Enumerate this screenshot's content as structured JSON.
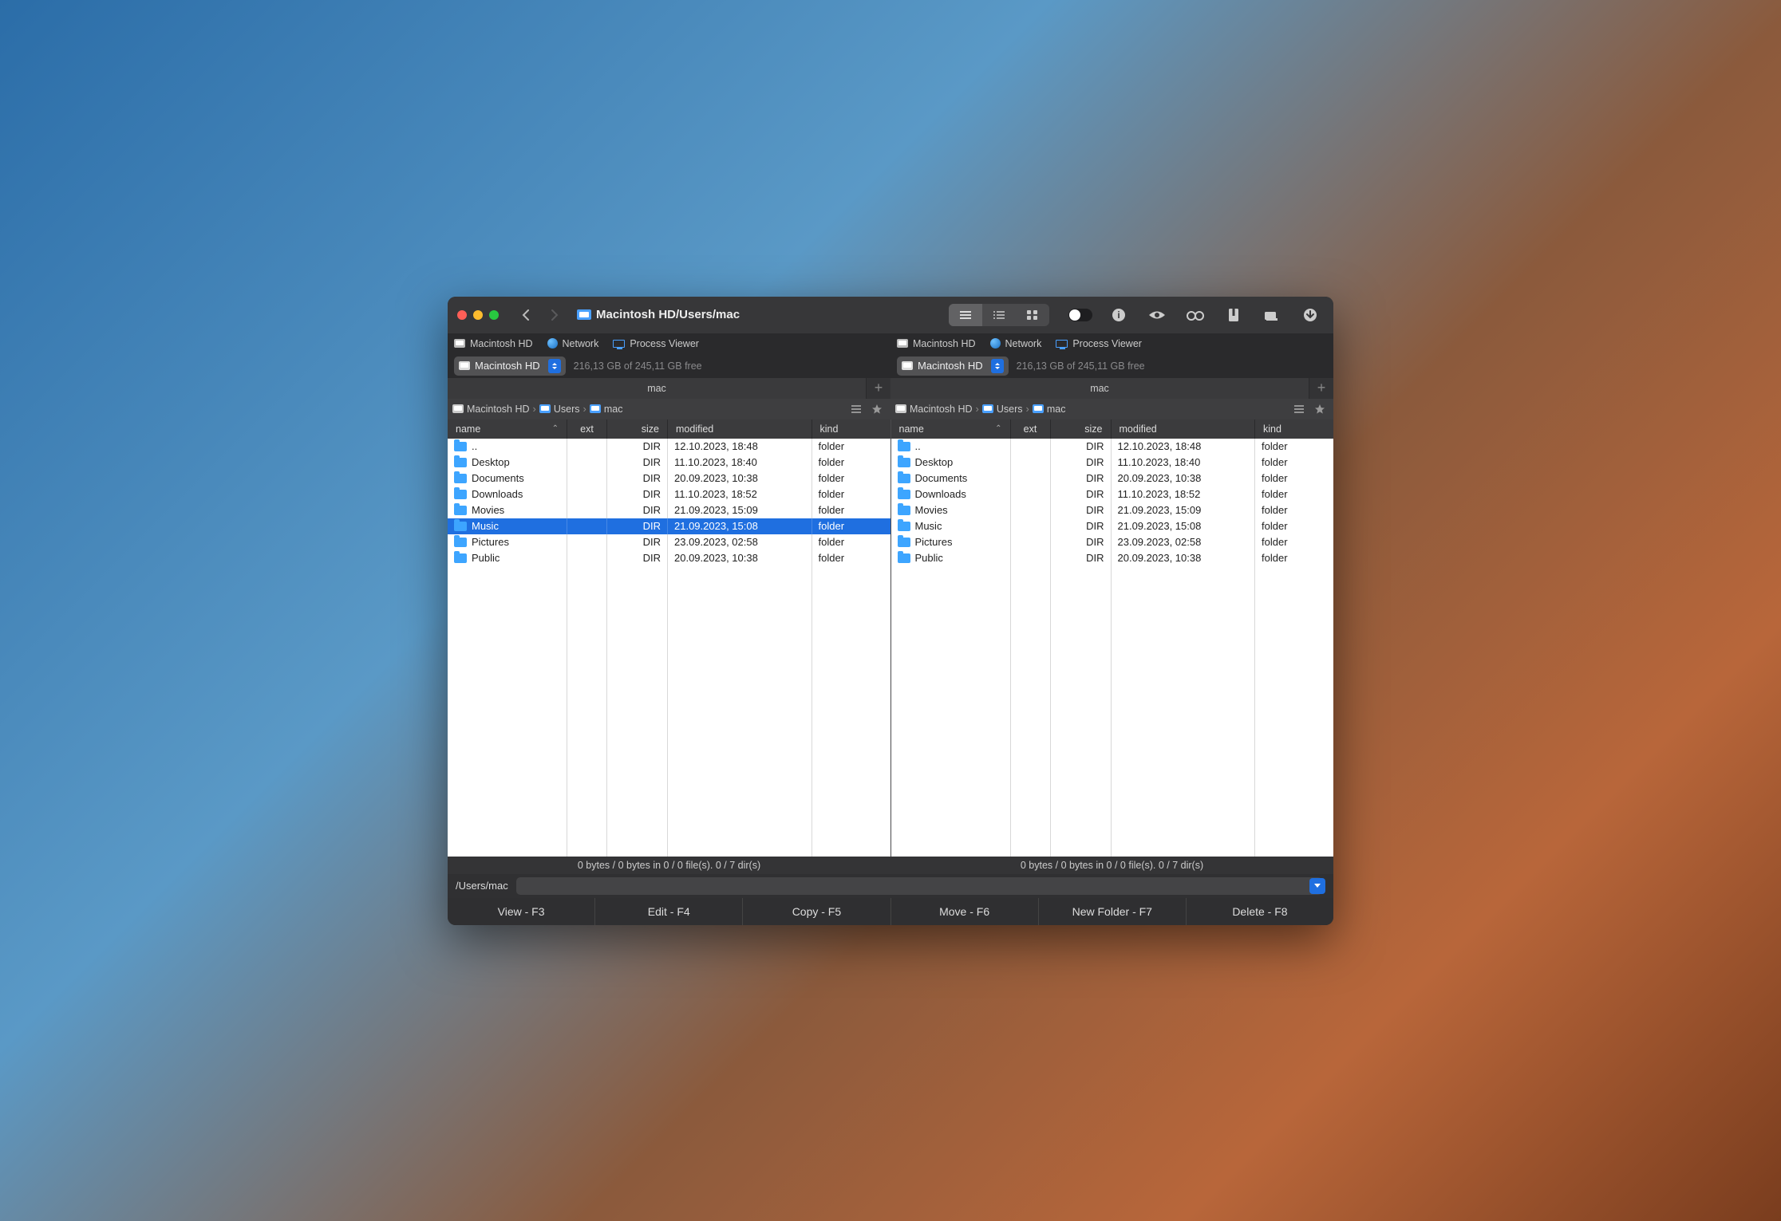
{
  "titlebar": {
    "path": "Macintosh HD/Users/mac"
  },
  "toolbar_icons": [
    "view-list",
    "view-columns",
    "view-grid",
    "show-hidden",
    "info",
    "quicklook",
    "binoculars",
    "archive",
    "share",
    "download"
  ],
  "pane_tabs": [
    {
      "icon": "hd",
      "label": "Macintosh HD"
    },
    {
      "icon": "net",
      "label": "Network"
    },
    {
      "icon": "proc",
      "label": "Process Viewer"
    }
  ],
  "disk": {
    "name": "Macintosh HD",
    "free": "216,13 GB of 245,11 GB free"
  },
  "dir_tab_label": "mac",
  "breadcrumb": [
    {
      "icon": "hd",
      "label": "Macintosh HD"
    },
    {
      "icon": "folder",
      "label": "Users"
    },
    {
      "icon": "folder",
      "label": "mac"
    }
  ],
  "columns": {
    "name": "name",
    "ext": "ext",
    "size": "size",
    "modified": "modified",
    "kind": "kind"
  },
  "rows_left": [
    {
      "name": "..",
      "size": "DIR",
      "modified": "12.10.2023, 18:48",
      "kind": "folder",
      "selected": false
    },
    {
      "name": "Desktop",
      "size": "DIR",
      "modified": "11.10.2023, 18:40",
      "kind": "folder",
      "selected": false
    },
    {
      "name": "Documents",
      "size": "DIR",
      "modified": "20.09.2023, 10:38",
      "kind": "folder",
      "selected": false
    },
    {
      "name": "Downloads",
      "size": "DIR",
      "modified": "11.10.2023, 18:52",
      "kind": "folder",
      "selected": false
    },
    {
      "name": "Movies",
      "size": "DIR",
      "modified": "21.09.2023, 15:09",
      "kind": "folder",
      "selected": false
    },
    {
      "name": "Music",
      "size": "DIR",
      "modified": "21.09.2023, 15:08",
      "kind": "folder",
      "selected": true
    },
    {
      "name": "Pictures",
      "size": "DIR",
      "modified": "23.09.2023, 02:58",
      "kind": "folder",
      "selected": false
    },
    {
      "name": "Public",
      "size": "DIR",
      "modified": "20.09.2023, 10:38",
      "kind": "folder",
      "selected": false
    }
  ],
  "rows_right": [
    {
      "name": "..",
      "size": "DIR",
      "modified": "12.10.2023, 18:48",
      "kind": "folder",
      "selected": false
    },
    {
      "name": "Desktop",
      "size": "DIR",
      "modified": "11.10.2023, 18:40",
      "kind": "folder",
      "selected": false
    },
    {
      "name": "Documents",
      "size": "DIR",
      "modified": "20.09.2023, 10:38",
      "kind": "folder",
      "selected": false
    },
    {
      "name": "Downloads",
      "size": "DIR",
      "modified": "11.10.2023, 18:52",
      "kind": "folder",
      "selected": false
    },
    {
      "name": "Movies",
      "size": "DIR",
      "modified": "21.09.2023, 15:09",
      "kind": "folder",
      "selected": false
    },
    {
      "name": "Music",
      "size": "DIR",
      "modified": "21.09.2023, 15:08",
      "kind": "folder",
      "selected": false
    },
    {
      "name": "Pictures",
      "size": "DIR",
      "modified": "23.09.2023, 02:58",
      "kind": "folder",
      "selected": false
    },
    {
      "name": "Public",
      "size": "DIR",
      "modified": "20.09.2023, 10:38",
      "kind": "folder",
      "selected": false
    }
  ],
  "status": "0 bytes / 0 bytes in 0 / 0 file(s). 0 / 7 dir(s)",
  "path_row": {
    "label": "/Users/mac",
    "value": ""
  },
  "fn": {
    "view": "View - F3",
    "edit": "Edit - F4",
    "copy": "Copy - F5",
    "move": "Move - F6",
    "newfolder": "New Folder - F7",
    "delete": "Delete - F8"
  }
}
